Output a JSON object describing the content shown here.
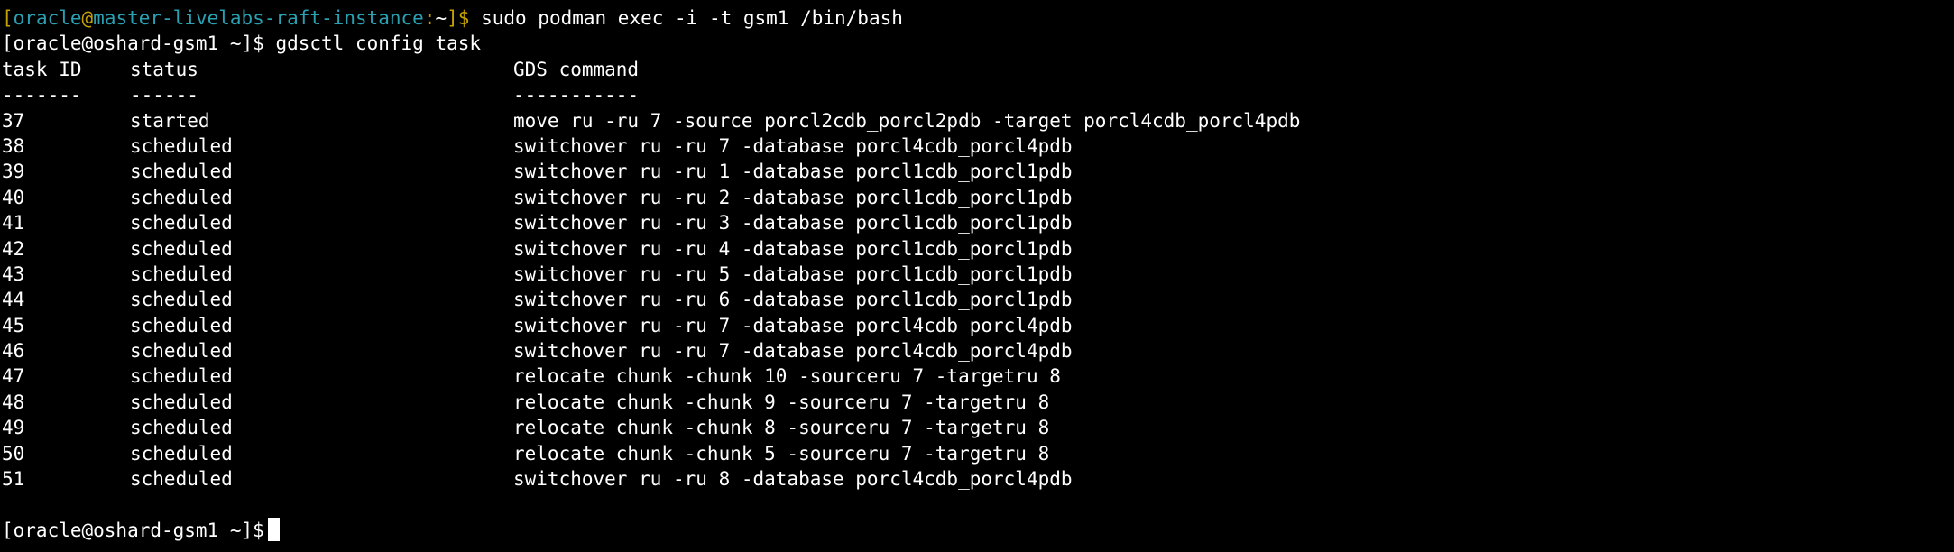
{
  "colors": {
    "background": "#000000",
    "text": "#ffffff",
    "prompt_bracket": "#c4a000",
    "prompt_user_host": "#2aa1b3",
    "cursor": "#ffffff"
  },
  "line1": {
    "open_bracket": "[",
    "user": "oracle",
    "at": "@",
    "host": "master-livelabs-raft-instance",
    "colon": ":",
    "path": "~",
    "close": "]$",
    "command": " sudo podman exec -i -t gsm1 /bin/bash"
  },
  "line2": {
    "prompt": "[oracle@oshard-gsm1 ~]$",
    "command": " gdsctl config task"
  },
  "table": {
    "headers": [
      "task ID",
      "status",
      "GDS command"
    ],
    "separators": [
      "-------",
      "------",
      "-----------"
    ],
    "rows": [
      [
        "37",
        "started",
        "move ru -ru 7 -source porcl2cdb_porcl2pdb -target porcl4cdb_porcl4pdb"
      ],
      [
        "38",
        "scheduled",
        "switchover ru -ru 7 -database porcl4cdb_porcl4pdb"
      ],
      [
        "39",
        "scheduled",
        "switchover ru -ru 1 -database porcl1cdb_porcl1pdb"
      ],
      [
        "40",
        "scheduled",
        "switchover ru -ru 2 -database porcl1cdb_porcl1pdb"
      ],
      [
        "41",
        "scheduled",
        "switchover ru -ru 3 -database porcl1cdb_porcl1pdb"
      ],
      [
        "42",
        "scheduled",
        "switchover ru -ru 4 -database porcl1cdb_porcl1pdb"
      ],
      [
        "43",
        "scheduled",
        "switchover ru -ru 5 -database porcl1cdb_porcl1pdb"
      ],
      [
        "44",
        "scheduled",
        "switchover ru -ru 6 -database porcl1cdb_porcl1pdb"
      ],
      [
        "45",
        "scheduled",
        "switchover ru -ru 7 -database porcl4cdb_porcl4pdb"
      ],
      [
        "46",
        "scheduled",
        "switchover ru -ru 7 -database porcl4cdb_porcl4pdb"
      ],
      [
        "47",
        "scheduled",
        "relocate chunk -chunk 10 -sourceru 7 -targetru 8"
      ],
      [
        "48",
        "scheduled",
        "relocate chunk -chunk 9 -sourceru 7 -targetru 8"
      ],
      [
        "49",
        "scheduled",
        "relocate chunk -chunk 8 -sourceru 7 -targetru 8"
      ],
      [
        "50",
        "scheduled",
        "relocate chunk -chunk 5 -sourceru 7 -targetru 8"
      ],
      [
        "51",
        "scheduled",
        "switchover ru -ru 8 -database porcl4cdb_porcl4pdb"
      ]
    ]
  },
  "final_prompt": "[oracle@oshard-gsm1 ~]$"
}
